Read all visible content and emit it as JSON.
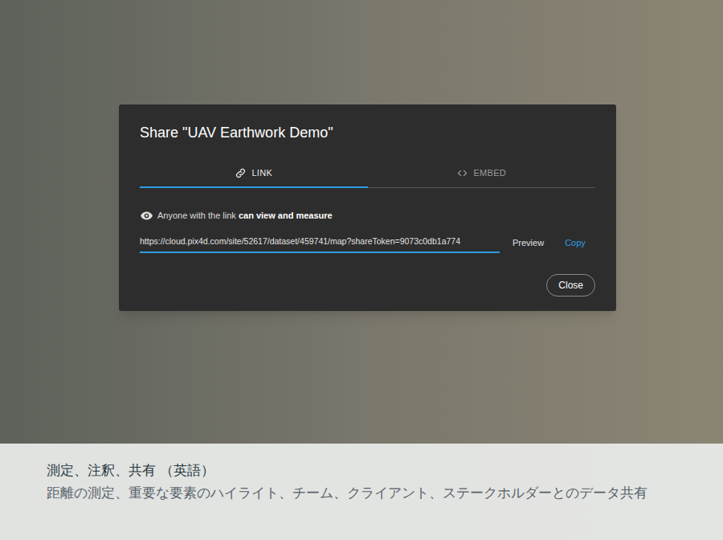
{
  "dialog": {
    "title": "Share \"UAV Earthwork Demo\"",
    "tabs": [
      {
        "label": "LINK",
        "selected": true
      },
      {
        "label": "EMBED",
        "selected": false
      }
    ],
    "permission": {
      "prefix": "Anyone with the link ",
      "emphasis": "can view and measure"
    },
    "link": {
      "value": "https://cloud.pix4d.com/site/52617/dataset/459741/map?shareToken=9073c0db1a774"
    },
    "actions": [
      "Preview",
      "Copy"
    ],
    "close": "Close"
  },
  "caption": {
    "title": "測定、注釈、共有 （英語）",
    "body": "距離の測定、重要な要素のハイライト、チーム、クライアント、ステークホルダーとのデータ共有"
  }
}
